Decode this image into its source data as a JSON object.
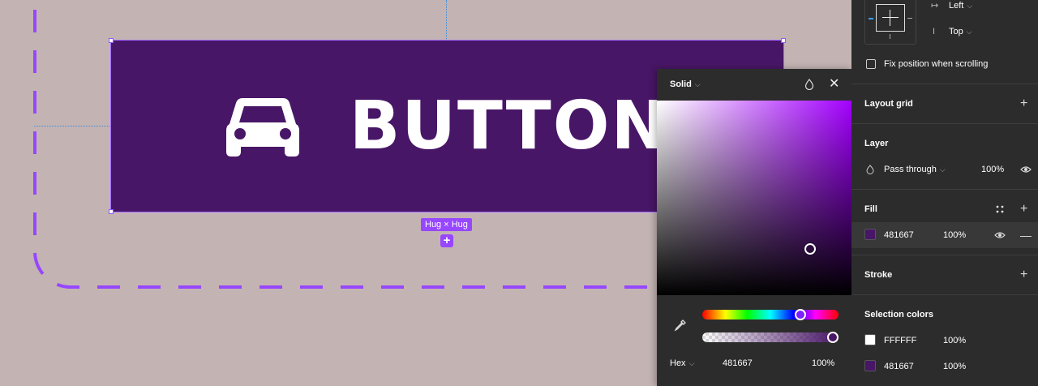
{
  "canvas": {
    "button_label": "BUTTON",
    "button_icon": "car-icon",
    "sizing_label": "Hug × Hug",
    "add_symbol": "+"
  },
  "color_picker": {
    "mode": "Solid",
    "format": "Hex",
    "hex_value": "481667",
    "opacity": "100%",
    "hue_fraction": 0.74,
    "alpha_fraction": 1.0,
    "close_symbol": "✕"
  },
  "panel": {
    "constraints": {
      "horizontal": "Left",
      "vertical": "Top"
    },
    "fix_position_label": "Fix position when scrolling",
    "layout_grid_title": "Layout grid",
    "layer": {
      "title": "Layer",
      "blend_mode": "Pass through",
      "opacity": "100%"
    },
    "fill": {
      "title": "Fill",
      "hex": "481667",
      "opacity": "100%"
    },
    "stroke_title": "Stroke",
    "selection_colors": {
      "title": "Selection colors",
      "items": [
        {
          "hex": "FFFFFF",
          "opacity": "100%",
          "color": "#ffffff"
        },
        {
          "hex": "481667",
          "opacity": "100%",
          "color": "#481667"
        }
      ]
    },
    "plus_symbol": "+",
    "minus_symbol": "—"
  },
  "colors": {
    "fill": "#481667",
    "selection": "#9747ff",
    "canvas_bg": "#c4b3b3",
    "panel_bg": "#2c2c2c"
  }
}
